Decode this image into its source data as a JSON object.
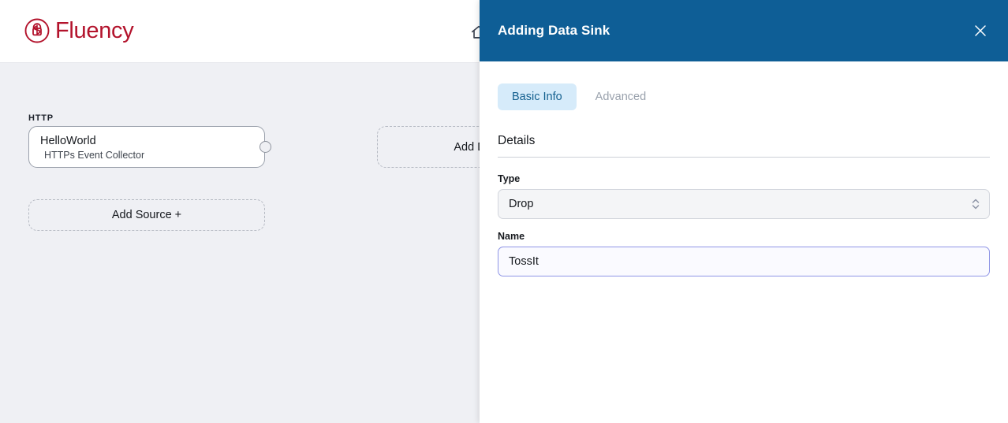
{
  "app": {
    "brand_name": "Fluency",
    "brand_color": "#b3132c",
    "logo_icon": "fluency-circle-lock-logo",
    "header_icons": [
      {
        "name": "home-icon",
        "glyph": "home"
      }
    ]
  },
  "canvas": {
    "background_color": "#eff0f4",
    "groups": [
      {
        "label": "HTTP",
        "node": {
          "title": "HelloWorld",
          "subtitle": "HTTPs Event Collector",
          "handle_icon": "connection-handle-icon"
        }
      }
    ],
    "add_source_button": "Add Source +",
    "add_sink_button": "Add Data Sink +"
  },
  "panel": {
    "title": "Adding Data Sink",
    "header_color": "#0e5e96",
    "close_icon": "close-icon",
    "tabs": [
      {
        "label": "Basic Info",
        "active": true
      },
      {
        "label": "Advanced",
        "active": false
      }
    ],
    "section": {
      "heading": "Details",
      "fields": {
        "type": {
          "label": "Type",
          "value": "Drop",
          "chevron_icon": "chevron-up-down-icon"
        },
        "name": {
          "label": "Name",
          "value": "TossIt",
          "placeholder": "Name",
          "focused": true,
          "focus_border_color": "#8f95e6"
        }
      }
    }
  }
}
